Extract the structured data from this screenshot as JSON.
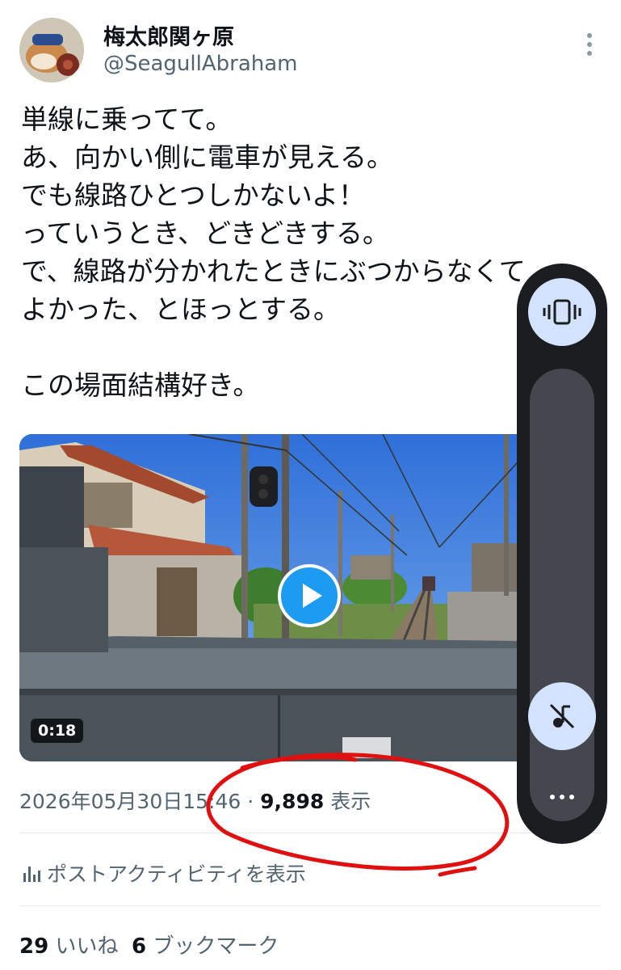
{
  "author": {
    "display_name": "梅太郎関ヶ原",
    "handle": "@SeagullAbraham"
  },
  "tweet": {
    "lines": [
      "単線に乗ってて。",
      "あ、向かい側に電車が見える。",
      "でも線路ひとつしかないよ！",
      "っていうとき、どきどきする。",
      "で、線路が分かれたときにぶつからなくて",
      "よかった、とほっとする。",
      "",
      "この場面結構好き。"
    ]
  },
  "video": {
    "duration": "0:18"
  },
  "meta": {
    "date": "2026年05月30日",
    "time": "15:46",
    "separator": "·",
    "views": "9,898",
    "views_label": "表示"
  },
  "activity": {
    "label": "ポストアクティビティを表示"
  },
  "stats": {
    "likes_count": "29",
    "likes_label": "いいね",
    "bookmarks_count": "6",
    "bookmarks_label": "ブックマーク"
  },
  "colors": {
    "accent": "#1d9bf0",
    "annotation": "#e01010",
    "panel": "#1b1d20",
    "panel_button": "#d3e3fd"
  },
  "icons": [
    "more-vertical-icon",
    "play-icon",
    "analytics-icon",
    "vibrate-icon",
    "music-mute-icon",
    "more-horizontal-icon"
  ]
}
